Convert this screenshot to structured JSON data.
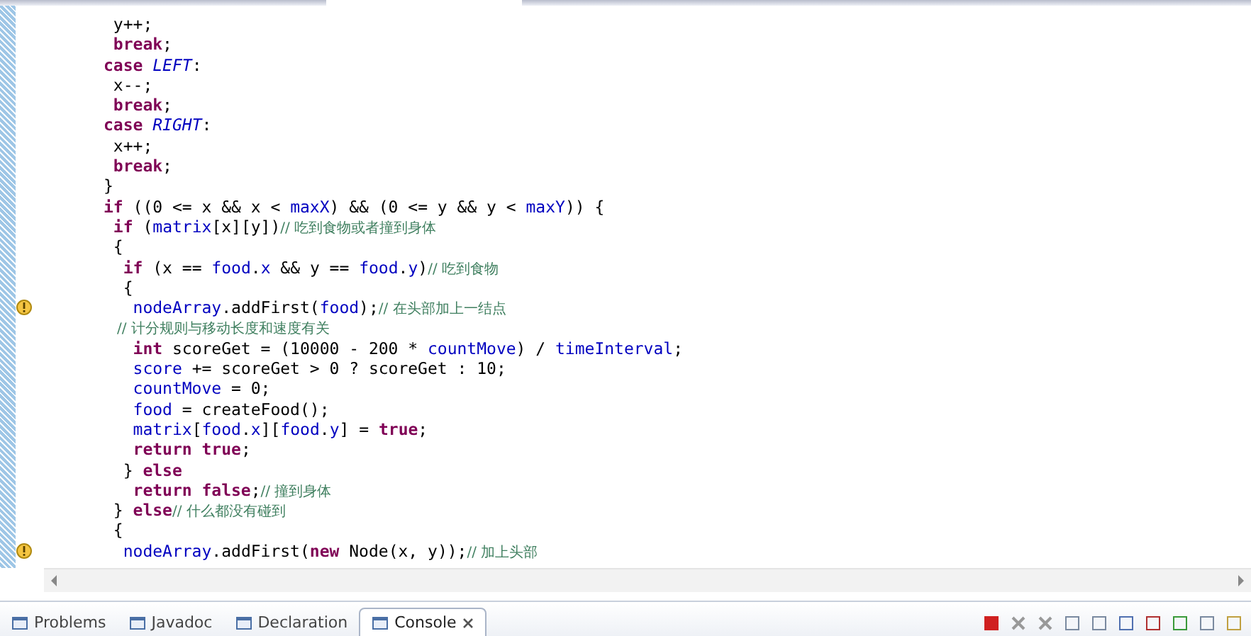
{
  "editor": {
    "lines": [
      {
        "warning": false,
        "tokens": [
          {
            "kind": "plain",
            "text": " y++;"
          }
        ]
      },
      {
        "warning": false,
        "tokens": [
          {
            "kind": "kw",
            "text": " break"
          },
          {
            "kind": "plain",
            "text": ";"
          }
        ]
      },
      {
        "warning": false,
        "tokens": [
          {
            "kind": "kw",
            "text": "case"
          },
          {
            "kind": "const",
            "text": " LEFT"
          },
          {
            "kind": "plain",
            "text": ":"
          }
        ]
      },
      {
        "warning": false,
        "tokens": [
          {
            "kind": "plain",
            "text": " x--;"
          }
        ]
      },
      {
        "warning": false,
        "tokens": [
          {
            "kind": "kw",
            "text": " break"
          },
          {
            "kind": "plain",
            "text": ";"
          }
        ]
      },
      {
        "warning": false,
        "tokens": [
          {
            "kind": "kw",
            "text": "case"
          },
          {
            "kind": "const",
            "text": " RIGHT"
          },
          {
            "kind": "plain",
            "text": ":"
          }
        ]
      },
      {
        "warning": false,
        "tokens": [
          {
            "kind": "plain",
            "text": " x++;"
          }
        ]
      },
      {
        "warning": false,
        "tokens": [
          {
            "kind": "kw",
            "text": " break"
          },
          {
            "kind": "plain",
            "text": ";"
          }
        ]
      },
      {
        "warning": false,
        "tokens": [
          {
            "kind": "plain",
            "text": "}"
          }
        ]
      },
      {
        "warning": false,
        "tokens": [
          {
            "kind": "kw",
            "text": "if"
          },
          {
            "kind": "plain",
            "text": " ((0 <= x && x < "
          },
          {
            "kind": "field",
            "text": "maxX"
          },
          {
            "kind": "plain",
            "text": ") && (0 <= y && y < "
          },
          {
            "kind": "field",
            "text": "maxY"
          },
          {
            "kind": "plain",
            "text": ")) {"
          }
        ]
      },
      {
        "warning": false,
        "tokens": [
          {
            "kind": "kw",
            "text": " if"
          },
          {
            "kind": "plain",
            "text": " ("
          },
          {
            "kind": "field",
            "text": "matrix"
          },
          {
            "kind": "plain",
            "text": "[x][y])"
          },
          {
            "kind": "comment",
            "text": "// 吃到食物或者撞到身体"
          }
        ]
      },
      {
        "warning": false,
        "tokens": [
          {
            "kind": "plain",
            "text": " {"
          }
        ]
      },
      {
        "warning": false,
        "tokens": [
          {
            "kind": "kw",
            "text": "  if"
          },
          {
            "kind": "plain",
            "text": " (x == "
          },
          {
            "kind": "field",
            "text": "food"
          },
          {
            "kind": "plain",
            "text": "."
          },
          {
            "kind": "field",
            "text": "x"
          },
          {
            "kind": "plain",
            "text": " && y == "
          },
          {
            "kind": "field",
            "text": "food"
          },
          {
            "kind": "plain",
            "text": "."
          },
          {
            "kind": "field",
            "text": "y"
          },
          {
            "kind": "plain",
            "text": ")"
          },
          {
            "kind": "comment",
            "text": "// 吃到食物"
          }
        ]
      },
      {
        "warning": false,
        "tokens": [
          {
            "kind": "plain",
            "text": "  {"
          }
        ]
      },
      {
        "warning": true,
        "tokens": [
          {
            "kind": "field",
            "text": "   nodeArray"
          },
          {
            "kind": "plain",
            "text": ".addFirst("
          },
          {
            "kind": "field",
            "text": "food"
          },
          {
            "kind": "plain",
            "text": ");"
          },
          {
            "kind": "comment",
            "text": "// 在头部加上一结点"
          }
        ]
      },
      {
        "warning": false,
        "tokens": [
          {
            "kind": "comment",
            "text": "   // 计分规则与移动长度和速度有关"
          }
        ]
      },
      {
        "warning": false,
        "tokens": [
          {
            "kind": "kw",
            "text": "   int"
          },
          {
            "kind": "plain",
            "text": " scoreGet = (10000 - 200 * "
          },
          {
            "kind": "field",
            "text": "countMove"
          },
          {
            "kind": "plain",
            "text": ") / "
          },
          {
            "kind": "field",
            "text": "timeInterval"
          },
          {
            "kind": "plain",
            "text": ";"
          }
        ]
      },
      {
        "warning": false,
        "tokens": [
          {
            "kind": "field",
            "text": "   score"
          },
          {
            "kind": "plain",
            "text": " += scoreGet > 0 ? scoreGet : 10;"
          }
        ]
      },
      {
        "warning": false,
        "tokens": [
          {
            "kind": "field",
            "text": "   countMove"
          },
          {
            "kind": "plain",
            "text": " = 0;"
          }
        ]
      },
      {
        "warning": false,
        "tokens": [
          {
            "kind": "field",
            "text": "   food"
          },
          {
            "kind": "plain",
            "text": " = createFood();"
          }
        ]
      },
      {
        "warning": false,
        "tokens": [
          {
            "kind": "field",
            "text": "   matrix"
          },
          {
            "kind": "plain",
            "text": "["
          },
          {
            "kind": "field",
            "text": "food"
          },
          {
            "kind": "plain",
            "text": "."
          },
          {
            "kind": "field",
            "text": "x"
          },
          {
            "kind": "plain",
            "text": "]["
          },
          {
            "kind": "field",
            "text": "food"
          },
          {
            "kind": "plain",
            "text": "."
          },
          {
            "kind": "field",
            "text": "y"
          },
          {
            "kind": "plain",
            "text": "] = "
          },
          {
            "kind": "kw",
            "text": "true"
          },
          {
            "kind": "plain",
            "text": ";"
          }
        ]
      },
      {
        "warning": false,
        "tokens": [
          {
            "kind": "kw",
            "text": "   return"
          },
          {
            "kind": "kw",
            "text": " true"
          },
          {
            "kind": "plain",
            "text": ";"
          }
        ]
      },
      {
        "warning": false,
        "tokens": [
          {
            "kind": "plain",
            "text": "  } "
          },
          {
            "kind": "kw",
            "text": "else"
          }
        ]
      },
      {
        "warning": false,
        "tokens": [
          {
            "kind": "kw",
            "text": "   return"
          },
          {
            "kind": "kw",
            "text": " false"
          },
          {
            "kind": "plain",
            "text": ";"
          },
          {
            "kind": "comment",
            "text": "// 撞到身体"
          }
        ]
      },
      {
        "warning": false,
        "tokens": [
          {
            "kind": "plain",
            "text": " } "
          },
          {
            "kind": "kw",
            "text": "else"
          },
          {
            "kind": "comment",
            "text": "// 什么都没有碰到"
          }
        ]
      },
      {
        "warning": false,
        "tokens": [
          {
            "kind": "plain",
            "text": " {"
          }
        ]
      },
      {
        "warning": true,
        "tokens": [
          {
            "kind": "field",
            "text": "  nodeArray"
          },
          {
            "kind": "plain",
            "text": ".addFirst("
          },
          {
            "kind": "kw",
            "text": "new"
          },
          {
            "kind": "plain",
            "text": " Node(x, y));"
          },
          {
            "kind": "comment",
            "text": "// 加上头部"
          }
        ]
      }
    ]
  },
  "bottom_panel": {
    "tabs": [
      {
        "label": "Problems",
        "selected": false
      },
      {
        "label": "Javadoc",
        "selected": false
      },
      {
        "label": "Declaration",
        "selected": false
      },
      {
        "label": "Console",
        "selected": true
      }
    ]
  }
}
